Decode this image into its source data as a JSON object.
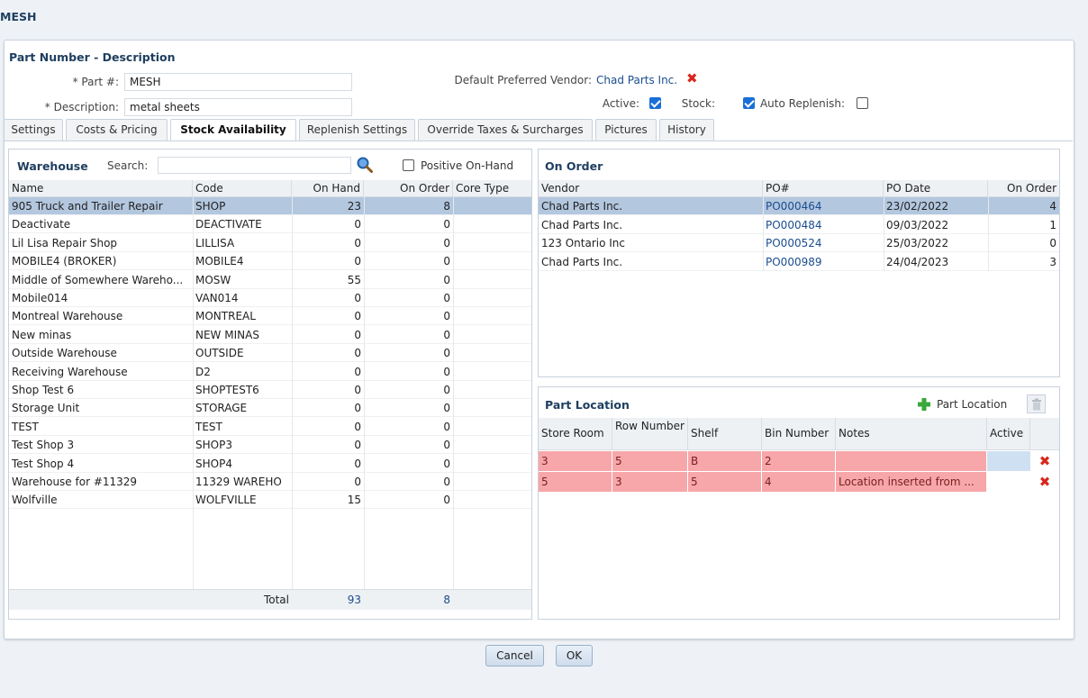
{
  "window": {
    "title": "MESH"
  },
  "header": {
    "section_title": "Part Number - Description",
    "part_label": "* Part #:",
    "part_value": "MESH",
    "desc_label": "* Description:",
    "desc_value": "metal sheets",
    "vendor_label": "Default Preferred Vendor:",
    "vendor_value": "Chad Parts Inc.",
    "active_label": "Active:",
    "stock_label": "Stock:",
    "auto_label": "Auto Replenish:"
  },
  "tabs": [
    {
      "label": "Settings"
    },
    {
      "label": "Costs & Pricing"
    },
    {
      "label": "Stock Availability"
    },
    {
      "label": "Replenish Settings"
    },
    {
      "label": "Override Taxes & Surcharges"
    },
    {
      "label": "Pictures"
    },
    {
      "label": "History"
    }
  ],
  "warehouse": {
    "title": "Warehouse",
    "search_label": "Search:",
    "positive_label": "Positive On-Hand",
    "columns": [
      "Name",
      "Code",
      "On Hand",
      "On Order",
      "Core Type"
    ],
    "rows": [
      {
        "name": "905 Truck and Trailer Repair",
        "code": "SHOP",
        "onhand": "23",
        "onorder": "8"
      },
      {
        "name": "Deactivate",
        "code": "DEACTIVATE",
        "onhand": "0",
        "onorder": "0"
      },
      {
        "name": "Lil Lisa Repair Shop",
        "code": "LILLISA",
        "onhand": "0",
        "onorder": "0"
      },
      {
        "name": "MOBILE4 (BROKER)",
        "code": "MOBILE4",
        "onhand": "0",
        "onorder": "0"
      },
      {
        "name": "Middle of Somewhere Wareho...",
        "code": "MOSW",
        "onhand": "55",
        "onorder": "0"
      },
      {
        "name": "Mobile014",
        "code": "VAN014",
        "onhand": "0",
        "onorder": "0"
      },
      {
        "name": "Montreal Warehouse",
        "code": "MONTREAL",
        "onhand": "0",
        "onorder": "0"
      },
      {
        "name": "New minas",
        "code": "NEW MINAS",
        "onhand": "0",
        "onorder": "0"
      },
      {
        "name": "Outside Warehouse",
        "code": "OUTSIDE",
        "onhand": "0",
        "onorder": "0"
      },
      {
        "name": "Receiving Warehouse",
        "code": "D2",
        "onhand": "0",
        "onorder": "0"
      },
      {
        "name": "Shop Test 6",
        "code": "SHOPTEST6",
        "onhand": "0",
        "onorder": "0"
      },
      {
        "name": "Storage Unit",
        "code": "STORAGE",
        "onhand": "0",
        "onorder": "0"
      },
      {
        "name": "TEST",
        "code": "TEST",
        "onhand": "0",
        "onorder": "0"
      },
      {
        "name": "Test Shop 3",
        "code": "SHOP3",
        "onhand": "0",
        "onorder": "0"
      },
      {
        "name": "Test Shop 4",
        "code": "SHOP4",
        "onhand": "0",
        "onorder": "0"
      },
      {
        "name": "Warehouse for #11329",
        "code": "11329 WAREHO",
        "onhand": "0",
        "onorder": "0"
      },
      {
        "name": "Wolfville",
        "code": "WOLFVILLE",
        "onhand": "15",
        "onorder": "0"
      }
    ],
    "total_label": "Total",
    "total_onhand": "93",
    "total_onorder": "8"
  },
  "on_order": {
    "title": "On Order",
    "columns": [
      "Vendor",
      "PO#",
      "PO Date",
      "On Order"
    ],
    "rows": [
      {
        "vendor": "Chad Parts Inc.",
        "po": "PO000464",
        "date": "23/02/2022",
        "qty": "4"
      },
      {
        "vendor": "Chad Parts Inc.",
        "po": "PO000484",
        "date": "09/03/2022",
        "qty": "1"
      },
      {
        "vendor": "123 Ontario Inc",
        "po": "PO000524",
        "date": "25/03/2022",
        "qty": "0"
      },
      {
        "vendor": "Chad Parts Inc.",
        "po": "PO000989",
        "date": "24/04/2023",
        "qty": "3"
      }
    ]
  },
  "part_location": {
    "title": "Part Location",
    "add_label": "Part Location",
    "columns": [
      "Store Room",
      "Row Number",
      "Shelf",
      "Bin Number",
      "Notes",
      "Active"
    ],
    "rows": [
      {
        "store": "3",
        "row": "5",
        "shelf": "B",
        "bin": "2",
        "notes": ""
      },
      {
        "store": "5",
        "row": "3",
        "shelf": "5",
        "bin": "4",
        "notes": "Location inserted from ..."
      }
    ]
  },
  "footer": {
    "cancel_label": "Cancel",
    "ok_label": "OK"
  },
  "colors": {
    "accent": "#1f3f60",
    "selected_row": "#b3c7df",
    "location_row": "#f7a6a9",
    "delete": "#d9261c"
  }
}
